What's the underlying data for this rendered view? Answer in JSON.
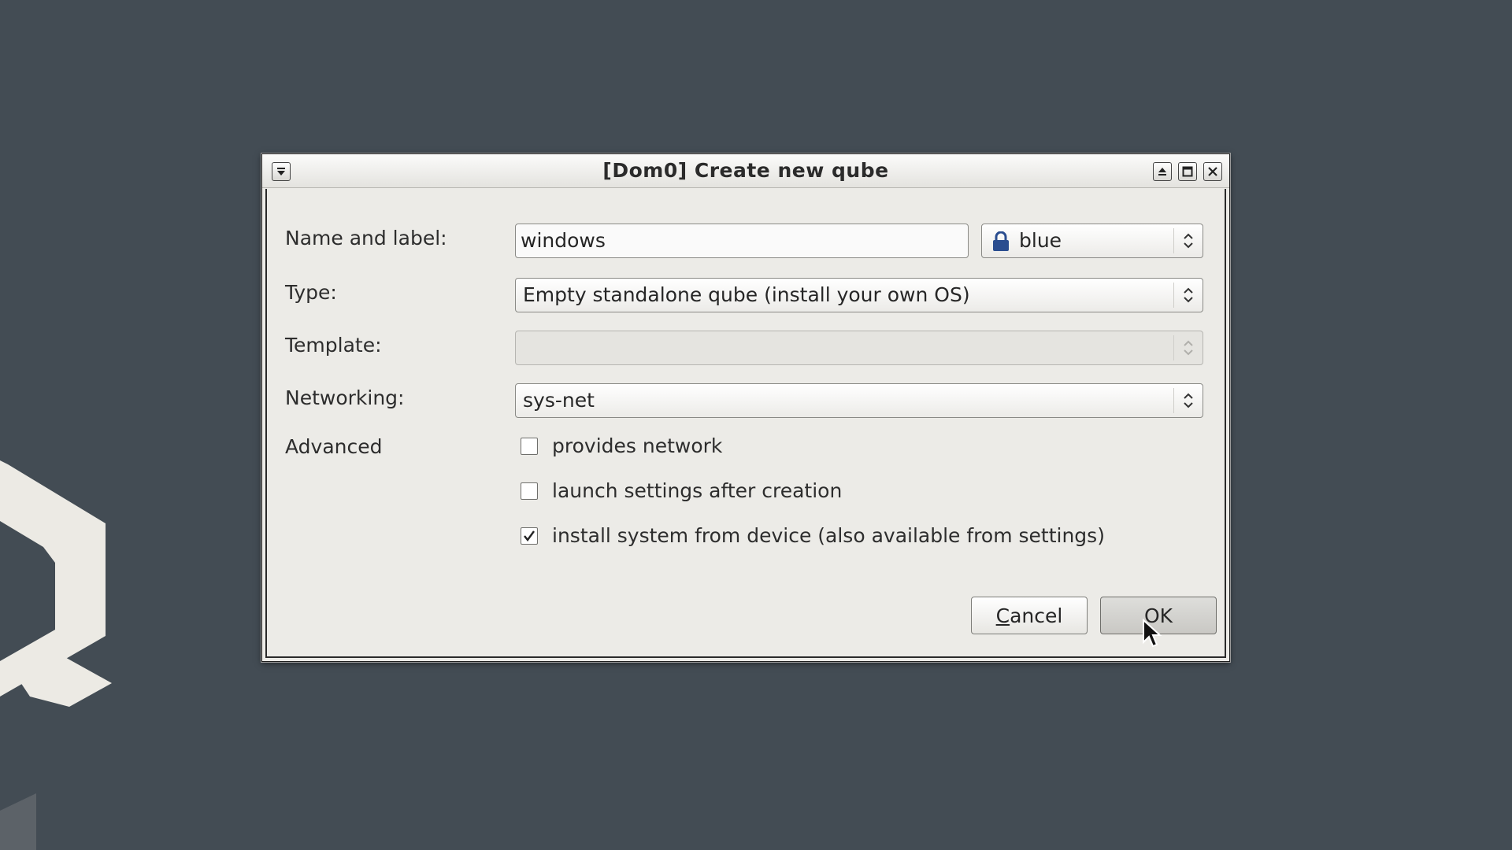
{
  "window": {
    "title": "[Dom0] Create new qube"
  },
  "form": {
    "name_label": "Name and label:",
    "name_value": "windows",
    "label_value": "blue",
    "label_color": "#2a4d8f",
    "type_label": "Type:",
    "type_value": "Empty standalone qube (install your own OS)",
    "template_label": "Template:",
    "template_value": "",
    "networking_label": "Networking:",
    "networking_value": "sys-net",
    "advanced_label": "Advanced"
  },
  "advanced": [
    {
      "label": "provides network",
      "checked": false
    },
    {
      "label": "launch settings after creation",
      "checked": false
    },
    {
      "label": "install system from device (also available from settings)",
      "checked": true
    }
  ],
  "buttons": {
    "cancel_mnemonic": "C",
    "cancel_rest": "ancel",
    "ok_label": "OK"
  }
}
